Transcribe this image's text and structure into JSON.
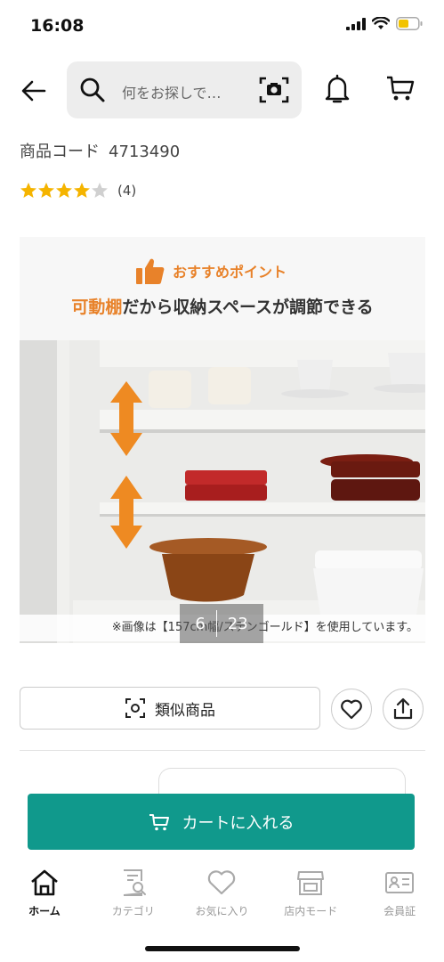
{
  "status_bar": {
    "time": "16:08"
  },
  "search": {
    "placeholder": "何をお探しで…"
  },
  "product": {
    "code_label": "商品コード",
    "code": "4713490",
    "rating": 4,
    "rating_max": 5,
    "review_count": "(4)"
  },
  "hero": {
    "point_label": "おすすめポイント",
    "headline_accent": "可動棚",
    "headline_rest": "だから収納スペースが調節できる",
    "note": "※画像は【157cm幅/ステンゴールド】を使用しています。",
    "pager_current": "6",
    "pager_total": "23"
  },
  "actions": {
    "similar_label": "類似商品"
  },
  "cta": {
    "cart_label": "カートに入れる"
  },
  "tabs": [
    {
      "label": "ホーム",
      "icon": "home-icon",
      "active": true
    },
    {
      "label": "カテゴリ",
      "icon": "category-icon",
      "active": false
    },
    {
      "label": "お気に入り",
      "icon": "heart-icon",
      "active": false
    },
    {
      "label": "店内モード",
      "icon": "store-icon",
      "active": false
    },
    {
      "label": "会員証",
      "icon": "member-card-icon",
      "active": false
    }
  ],
  "colors": {
    "accent_orange": "#e8822a",
    "cta_teal": "#10998c",
    "star_gold": "#f5b400"
  }
}
